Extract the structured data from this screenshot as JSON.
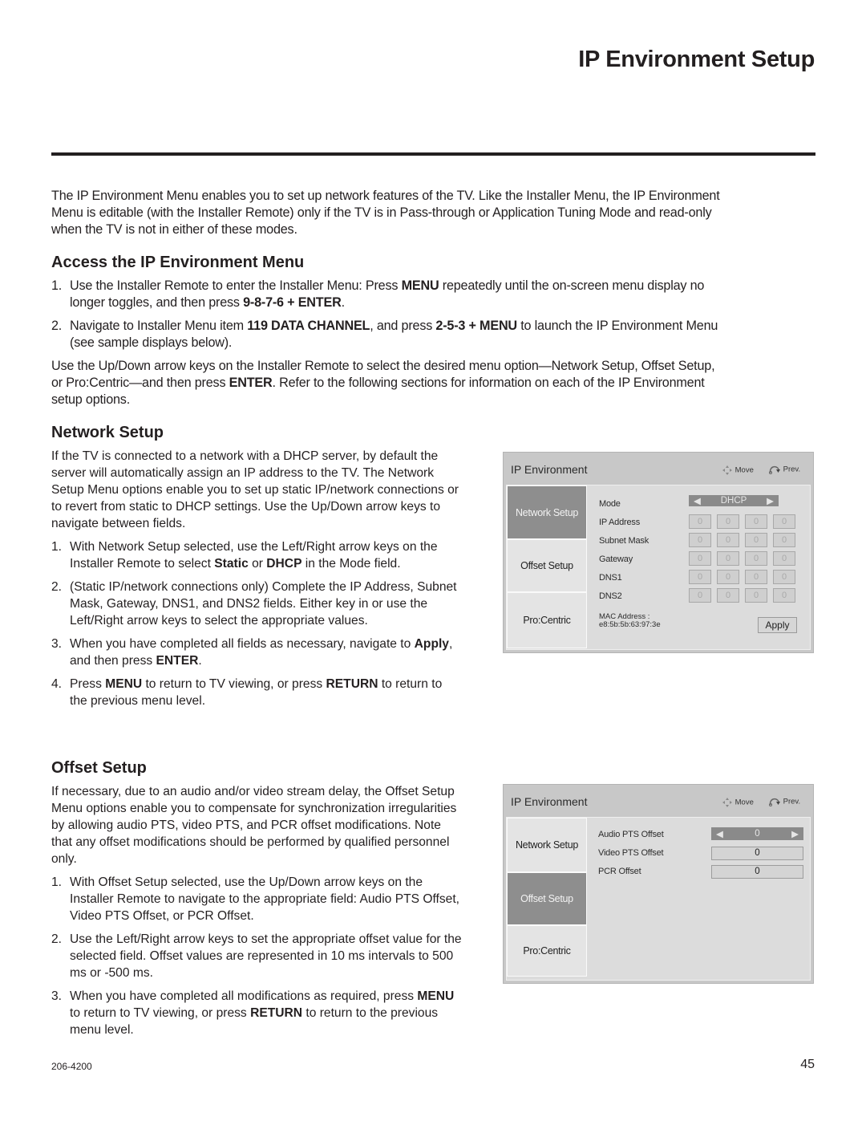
{
  "page": {
    "title": "IP Environment Setup",
    "intro": "The IP Environment Menu enables you to set up network features of the TV. Like the Installer Menu, the IP Environment Menu is editable (with the Installer Remote) only if the TV is in Pass-through or Application Tuning Mode and read-only when the TV is not in either of these modes.",
    "doc_number": "206-4200",
    "page_number": "45"
  },
  "access": {
    "heading": "Access the IP Environment Menu",
    "steps": [
      {
        "num": "1.",
        "parts": [
          "Use the Installer Remote to enter the Installer Menu: Press ",
          "MENU",
          " repeatedly until the on-screen menu display no longer toggles, and then press ",
          "9-8-7-6 + ENTER",
          "."
        ]
      },
      {
        "num": "2.",
        "parts": [
          "Navigate to Installer Menu item ",
          "119 DATA CHANNEL",
          ", and press ",
          "2-5-3 + MENU",
          " to launch the IP Environment Menu (see sample displays below)."
        ]
      }
    ],
    "note_parts": [
      "Use the Up/Down arrow keys on the Installer Remote to select the desired menu option—Network Setup, Offset Setup, or Pro:Centric—and then press ",
      "ENTER",
      ". Refer to the following sections for information on each of the IP Environment setup options."
    ]
  },
  "network": {
    "heading": "Network Setup",
    "intro": "If the TV is connected to a network with a DHCP server, by default the server will automatically assign an IP address to the TV. The Network Setup Menu options enable you to set up static IP/network connections or to revert from static to DHCP settings. Use the Up/Down arrow keys to navigate between fields.",
    "steps": [
      {
        "num": "1.",
        "parts": [
          "With Network Setup selected, use the Left/Right arrow keys on the Installer Remote to select ",
          "Static",
          " or ",
          "DHCP",
          " in the Mode field."
        ]
      },
      {
        "num": "2.",
        "parts": [
          "(Static IP/network connections only) Complete the IP Address, Subnet Mask, Gateway, DNS1, and DNS2 fields. Either key in or use the Left/Right arrow keys to select the appropriate values."
        ]
      },
      {
        "num": "3.",
        "parts": [
          "When you have completed all fields as necessary, navigate to ",
          "Apply",
          ", and then press ",
          "ENTER",
          "."
        ]
      },
      {
        "num": "4.",
        "parts": [
          "Press ",
          "MENU",
          " to return to TV viewing, or press ",
          "RETURN",
          " to return to the previous menu level."
        ]
      }
    ]
  },
  "offset": {
    "heading": "Offset Setup",
    "intro": "If necessary, due to an audio and/or video stream delay, the Offset Setup Menu options enable you to compensate for synchronization irregularities by allowing audio PTS, video PTS, and PCR offset modifications. Note that any offset modifications should be performed by qualified personnel only.",
    "steps": [
      {
        "num": "1.",
        "parts": [
          "With Offset Setup selected, use the Up/Down arrow keys on the Installer Remote to navigate to the appropriate field: Audio PTS Offset, Video PTS Offset, or PCR Offset."
        ]
      },
      {
        "num": "2.",
        "parts": [
          "Use the Left/Right arrow keys to set the appropriate offset value for the selected field. Offset values are represented in 10 ms intervals to 500 ms or -500 ms."
        ]
      },
      {
        "num": "3.",
        "parts": [
          "When you have completed all modifications as required, press ",
          "MENU",
          " to return to TV viewing, or press ",
          "RETURN",
          " to return to the previous menu level."
        ]
      }
    ]
  },
  "tv_network": {
    "title": "IP Environment",
    "hint_move": "Move",
    "hint_prev": "Prev.",
    "tabs": [
      "Network Setup",
      "Offset Setup",
      "Pro:Centric"
    ],
    "active_tab": 0,
    "mode_label": "Mode",
    "mode_value": "DHCP",
    "fields": [
      {
        "label": "IP Address",
        "octets": [
          "0",
          "0",
          "0",
          "0"
        ]
      },
      {
        "label": "Subnet Mask",
        "octets": [
          "0",
          "0",
          "0",
          "0"
        ]
      },
      {
        "label": "Gateway",
        "octets": [
          "0",
          "0",
          "0",
          "0"
        ]
      },
      {
        "label": "DNS1",
        "octets": [
          "0",
          "0",
          "0",
          "0"
        ]
      },
      {
        "label": "DNS2",
        "octets": [
          "0",
          "0",
          "0",
          "0"
        ]
      }
    ],
    "mac_label": "MAC Address :",
    "mac_value": "e8:5b:5b:63:97:3e",
    "apply_label": "Apply"
  },
  "tv_offset": {
    "title": "IP Environment",
    "hint_move": "Move",
    "hint_prev": "Prev.",
    "tabs": [
      "Network Setup",
      "Offset Setup",
      "Pro:Centric"
    ],
    "active_tab": 1,
    "fields": [
      {
        "label": "Audio PTS Offset",
        "value": "0"
      },
      {
        "label": "Video PTS Offset",
        "value": "0"
      },
      {
        "label": "PCR Offset",
        "value": "0"
      }
    ]
  }
}
